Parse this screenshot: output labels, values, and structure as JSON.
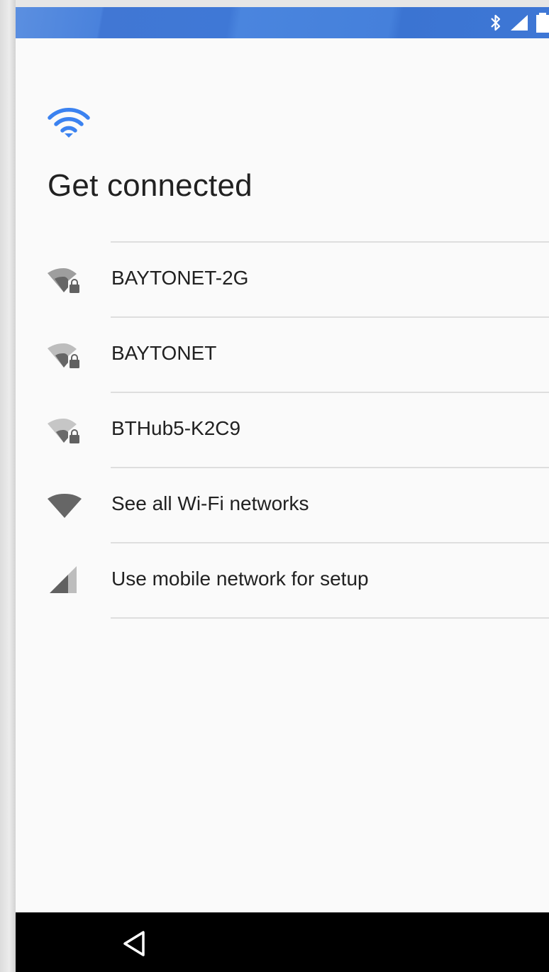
{
  "status_bar": {
    "icons": [
      "bluetooth-icon",
      "cellular-signal-icon",
      "battery-icon"
    ]
  },
  "header": {
    "icon": "wifi-icon",
    "title": "Get connected"
  },
  "networks": [
    {
      "label": "BAYTONET-2G",
      "icon": "wifi-locked-icon"
    },
    {
      "label": "BAYTONET",
      "icon": "wifi-locked-icon"
    },
    {
      "label": "BTHub5-K2C9",
      "icon": "wifi-locked-icon"
    },
    {
      "label": "See all Wi-Fi networks",
      "icon": "wifi-icon"
    },
    {
      "label": "Use mobile network for setup",
      "icon": "cellular-signal-icon"
    }
  ],
  "nav_bar": {
    "icons": [
      "back-icon"
    ]
  },
  "colors": {
    "status_bar": "#4279d6",
    "accent_wifi": "#3b82f0",
    "icon_gray": "#757575",
    "background": "#fafafa",
    "nav_bar": "#000000"
  }
}
